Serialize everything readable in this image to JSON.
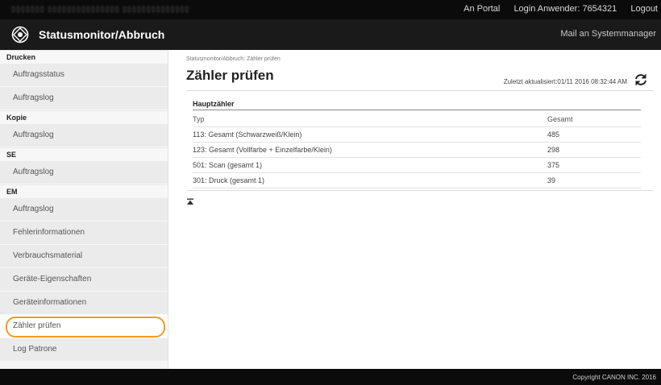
{
  "topbar": {
    "blurred_left": "▯▯▯▯▯▯▯   ▯▯▯▯▯▯▯▯▯▯▯▯▯▯▯   ▯▯▯▯▯▯▯▯▯▯▯▯▯▯",
    "portal_link": "An Portal",
    "login_user": "Login Anwender: 7654321",
    "logout": "Logout"
  },
  "header": {
    "title": "Statusmonitor/Abbruch",
    "mail_link": "Mail an Systemmanager"
  },
  "sidebar": {
    "sections": [
      {
        "title": "Drucken",
        "items": [
          "Auftragsstatus",
          "Auftragslog"
        ]
      },
      {
        "title": "Kopie",
        "items": [
          "Auftragslog"
        ]
      },
      {
        "title": "SE",
        "items": [
          "Auftragslog"
        ]
      },
      {
        "title": "EM",
        "items": [
          "Auftragslog",
          "Fehlerinformationen",
          "Verbrauchsmaterial",
          "Geräte-Eigenschaften",
          "Geräteinformationen",
          "Zähler prüfen",
          "Log Patrone"
        ]
      }
    ]
  },
  "main": {
    "breadcrumb": "Statusmonitor/Abbruch: Zähler prüfen",
    "title": "Zähler prüfen",
    "last_updated": "Zuletzt aktualisiert:01/11 2016 08:32:44 AM",
    "section_title": "Hauptzähler",
    "columns": [
      "Typ",
      "Gesamt"
    ],
    "rows": [
      [
        "113: Gesamt (Schwarzweiß/Klein)",
        "485"
      ],
      [
        "123: Gesamt (Vollfarbe + Einzelfarbe/Klein)",
        "298"
      ],
      [
        "501: Scan (gesamt 1)",
        "375"
      ],
      [
        "301: Druck (gesamt 1)",
        "39"
      ]
    ]
  },
  "footer": {
    "copyright": "Copyright CANON INC. 2016"
  },
  "colors": {
    "highlight_ring": "#f59a21",
    "header_bg": "#1a1a1a",
    "sidebar_bg": "#ebebeb"
  }
}
